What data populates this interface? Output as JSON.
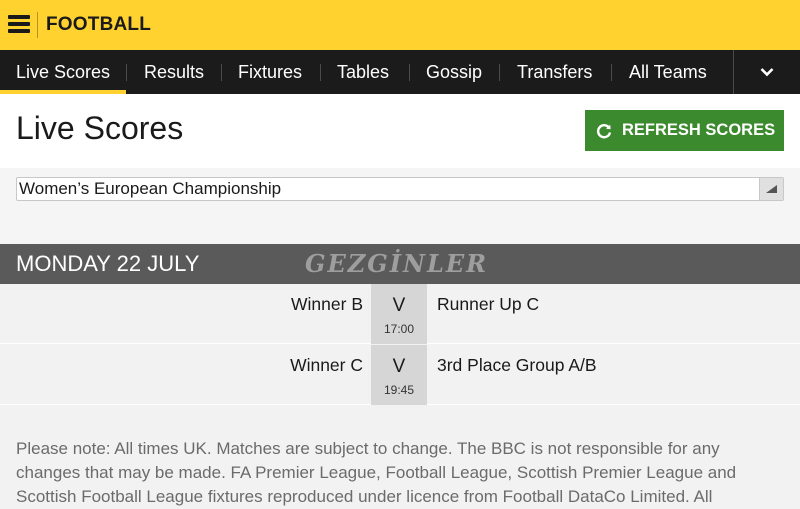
{
  "topbar": {
    "brand": "FOOTBALL",
    "menu_icon": "hamburger-menu-icon"
  },
  "nav": {
    "items": [
      {
        "label": "Live Scores",
        "active": true
      },
      {
        "label": "Results",
        "active": false
      },
      {
        "label": "Fixtures",
        "active": false
      },
      {
        "label": "Tables",
        "active": false
      },
      {
        "label": "Gossip",
        "active": false
      },
      {
        "label": "Transfers",
        "active": false
      },
      {
        "label": "All Teams",
        "active": false
      }
    ],
    "more_icon": "chevron-down-icon"
  },
  "page": {
    "title": "Live Scores",
    "refresh_label": "REFRESH SCORES",
    "refresh_icon": "refresh-icon"
  },
  "filter": {
    "selected": "Women’s European Championship",
    "arrow_icon": "dropdown-arrow-icon"
  },
  "date_heading": "MONDAY 22 JULY",
  "watermark": "GEZGİNLER",
  "fixtures": [
    {
      "home": "Winner B",
      "vs": "V",
      "time": "17:00",
      "away": "Runner Up C"
    },
    {
      "home": "Winner C",
      "vs": "V",
      "time": "19:45",
      "away": "3rd Place Group A/B"
    }
  ],
  "note": "Please note: All times UK. Matches are subject to change. The BBC is not responsible for any changes that may be made. FA Premier League, Football League, Scottish Premier League and Scottish Football League fixtures reproduced under licence from Football DataCo Limited. All",
  "colors": {
    "brand_yellow": "#ffd230",
    "nav_bg": "#1b1b1b",
    "refresh_green": "#3c8a2e",
    "date_band": "#5a5a5a"
  }
}
